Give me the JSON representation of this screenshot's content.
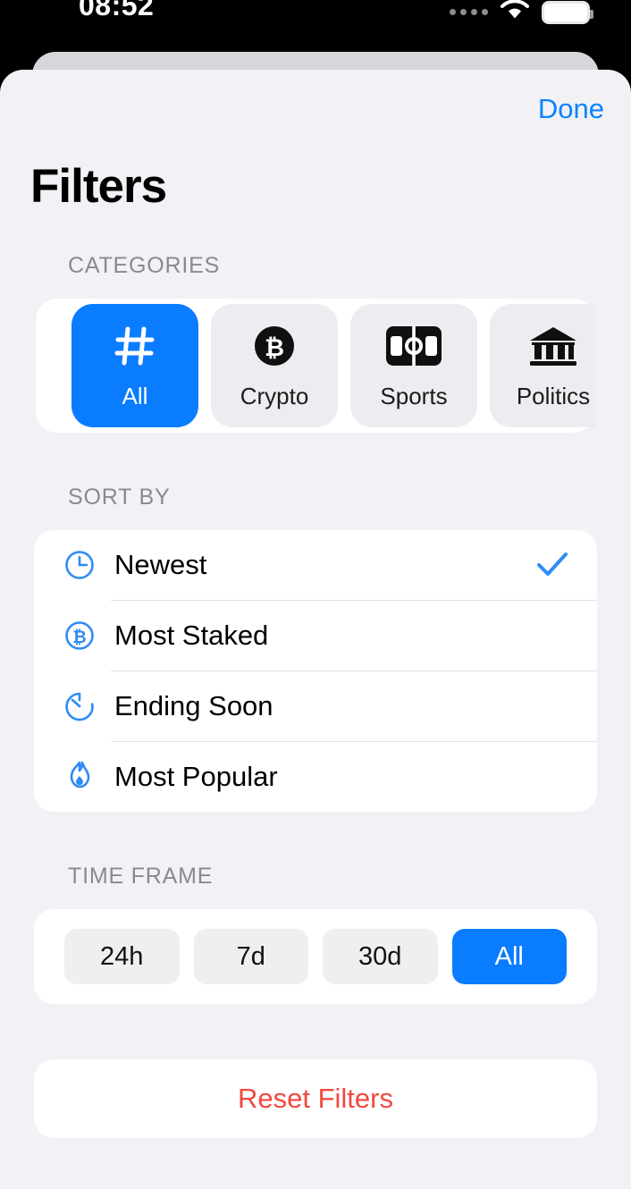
{
  "status_bar": {
    "time": "08:52",
    "signal_icon": "signal-dots-icon",
    "wifi_icon": "wifi-icon",
    "battery_icon": "battery-icon"
  },
  "sheet": {
    "done_label": "Done",
    "title": "Filters"
  },
  "categories": {
    "label": "CATEGORIES",
    "items": [
      {
        "label": "All",
        "icon": "hashtag-icon",
        "selected": true
      },
      {
        "label": "Crypto",
        "icon": "bitcoin-circle-icon",
        "selected": false
      },
      {
        "label": "Sports",
        "icon": "soccer-field-icon",
        "selected": false
      },
      {
        "label": "Politics",
        "icon": "bank-building-icon",
        "selected": false
      }
    ]
  },
  "sort_by": {
    "label": "SORT BY",
    "items": [
      {
        "label": "Newest",
        "icon": "clock-icon",
        "selected": true
      },
      {
        "label": "Most Staked",
        "icon": "bitcoin-circle-icon",
        "selected": false
      },
      {
        "label": "Ending Soon",
        "icon": "timer-icon",
        "selected": false
      },
      {
        "label": "Most Popular",
        "icon": "flame-icon",
        "selected": false
      }
    ],
    "check_icon": "checkmark-icon"
  },
  "time_frame": {
    "label": "TIME FRAME",
    "options": [
      {
        "label": "24h",
        "selected": false
      },
      {
        "label": "7d",
        "selected": false
      },
      {
        "label": "30d",
        "selected": false
      },
      {
        "label": "All",
        "selected": true
      }
    ]
  },
  "reset": {
    "label": "Reset Filters"
  },
  "colors": {
    "accent_blue": "#0a7cff",
    "link_blue": "#0a84ff",
    "destructive_red": "#f1493f",
    "sheet_background": "#f1f1f6",
    "card_background": "#ffffff",
    "section_label": "#8a8a8e"
  }
}
